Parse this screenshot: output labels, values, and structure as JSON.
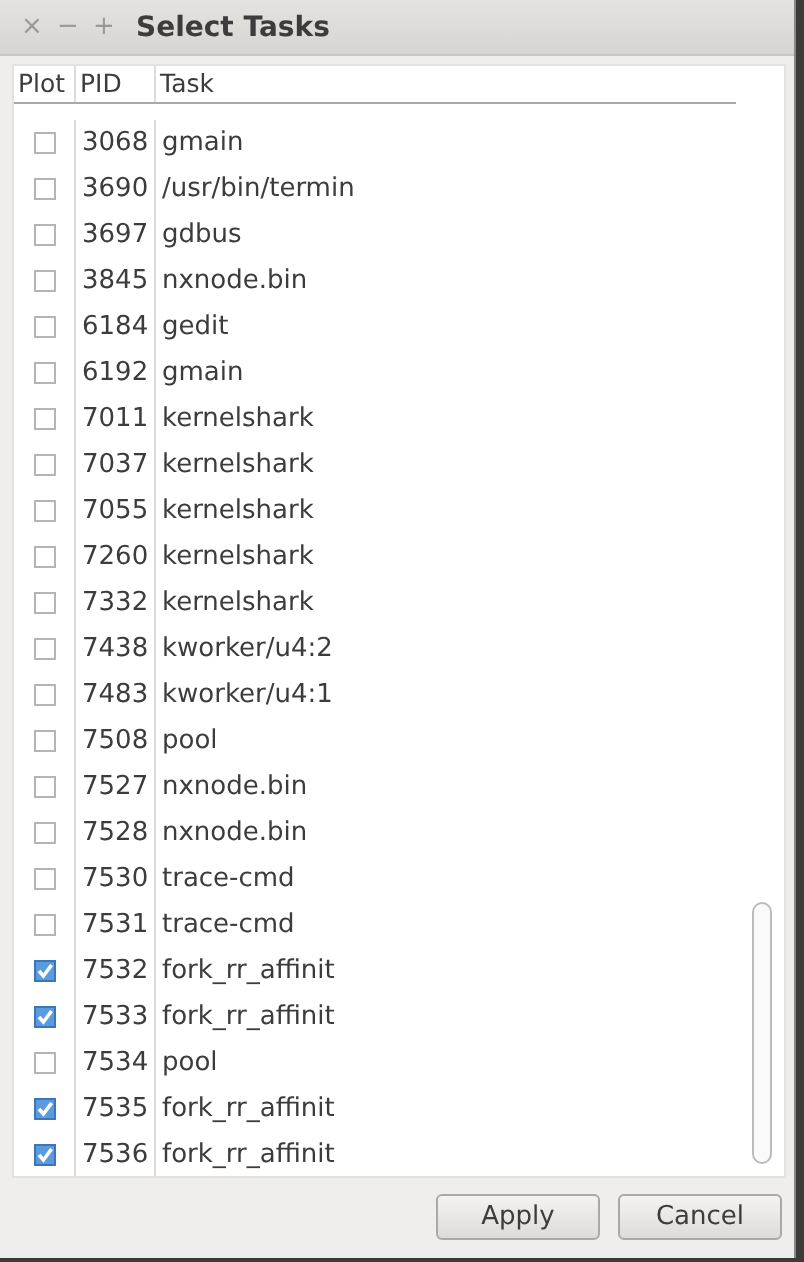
{
  "window": {
    "title": "Select Tasks",
    "controls": [
      "×",
      "−",
      "+"
    ]
  },
  "table": {
    "columns": [
      "Plot",
      "PID",
      "Task"
    ],
    "rows": [
      {
        "checked": false,
        "pid": "3068",
        "task": "gmain"
      },
      {
        "checked": false,
        "pid": "3690",
        "task": "/usr/bin/termin"
      },
      {
        "checked": false,
        "pid": "3697",
        "task": "gdbus"
      },
      {
        "checked": false,
        "pid": "3845",
        "task": "nxnode.bin"
      },
      {
        "checked": false,
        "pid": "6184",
        "task": "gedit"
      },
      {
        "checked": false,
        "pid": "6192",
        "task": "gmain"
      },
      {
        "checked": false,
        "pid": "7011",
        "task": "kernelshark"
      },
      {
        "checked": false,
        "pid": "7037",
        "task": "kernelshark"
      },
      {
        "checked": false,
        "pid": "7055",
        "task": "kernelshark"
      },
      {
        "checked": false,
        "pid": "7260",
        "task": "kernelshark"
      },
      {
        "checked": false,
        "pid": "7332",
        "task": "kernelshark"
      },
      {
        "checked": false,
        "pid": "7438",
        "task": "kworker/u4:2"
      },
      {
        "checked": false,
        "pid": "7483",
        "task": "kworker/u4:1"
      },
      {
        "checked": false,
        "pid": "7508",
        "task": "pool"
      },
      {
        "checked": false,
        "pid": "7527",
        "task": "nxnode.bin"
      },
      {
        "checked": false,
        "pid": "7528",
        "task": "nxnode.bin"
      },
      {
        "checked": false,
        "pid": "7530",
        "task": "trace-cmd"
      },
      {
        "checked": false,
        "pid": "7531",
        "task": "trace-cmd"
      },
      {
        "checked": true,
        "pid": "7532",
        "task": "fork_rr_affinit"
      },
      {
        "checked": true,
        "pid": "7533",
        "task": "fork_rr_affinit"
      },
      {
        "checked": false,
        "pid": "7534",
        "task": "pool"
      },
      {
        "checked": true,
        "pid": "7535",
        "task": "fork_rr_affinit"
      },
      {
        "checked": true,
        "pid": "7536",
        "task": "fork_rr_affinit"
      }
    ]
  },
  "buttons": [
    "Apply",
    "Cancel"
  ]
}
